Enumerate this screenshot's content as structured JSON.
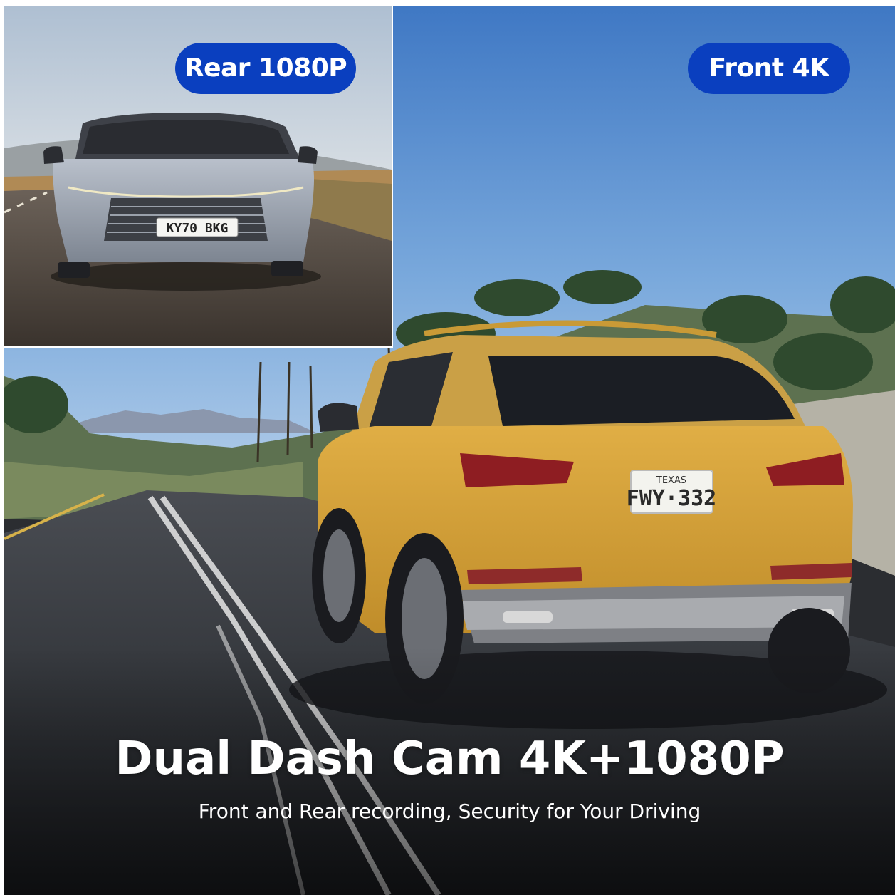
{
  "badges": {
    "rear": "Rear 1080P",
    "front": "Front 4K"
  },
  "plates": {
    "rear_car": "KY70 BKG",
    "front_car_state": "TEXAS",
    "front_car": "FWY·332"
  },
  "headline": "Dual Dash Cam 4K+1080P",
  "subheadline": "Front and Rear recording, Security for Your Driving",
  "colors": {
    "badge_blue": "#0a3fbf",
    "sky_blue": "#4f86cc",
    "road_dark": "#2f3136",
    "suv_yellow": "#d9a53a",
    "sedan_silver": "#9aa3b0"
  }
}
